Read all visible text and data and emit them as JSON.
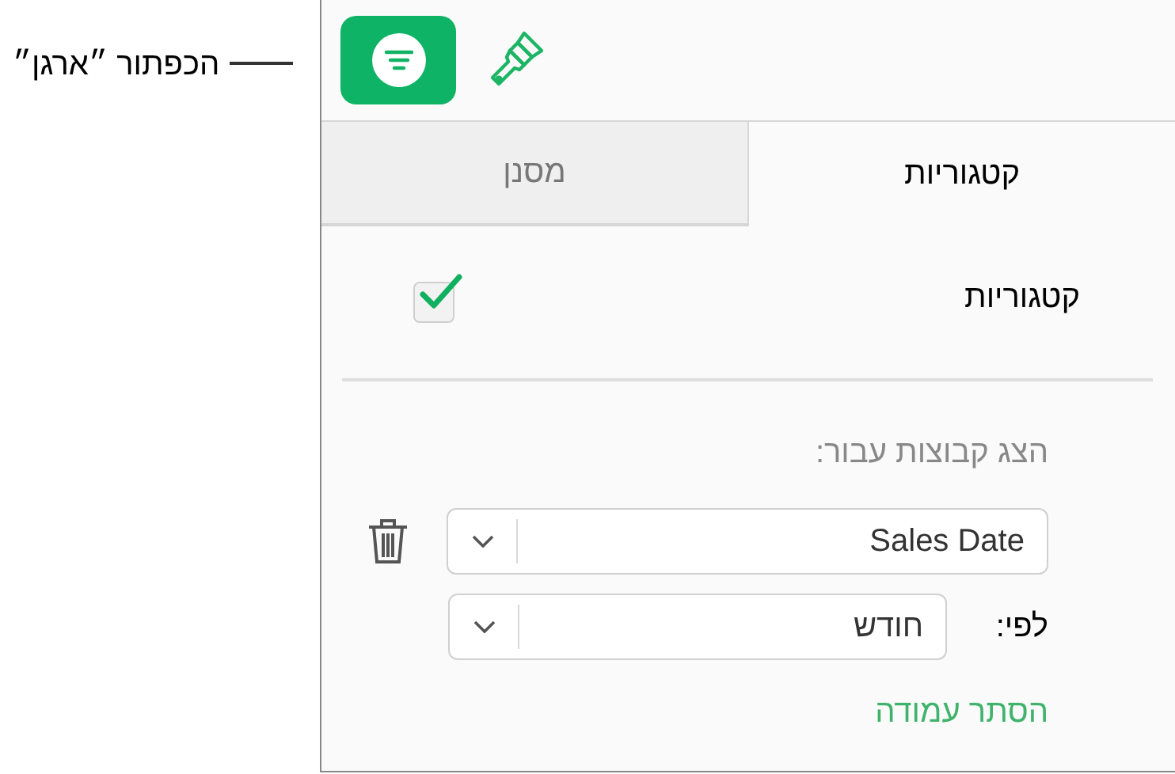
{
  "callout": {
    "label": "הכפתור ״ארגן״"
  },
  "toolbar": [
    {
      "kind": "organize",
      "selected": true
    },
    {
      "kind": "format",
      "selected": false
    }
  ],
  "tabs": [
    {
      "label": "קטגוריות",
      "selected": true
    },
    {
      "label": "מסנן",
      "selected": false
    }
  ],
  "categories_checkbox": {
    "label": "קטגוריות",
    "checked": true
  },
  "group_by": {
    "label": "הצג קבוצות עבור:",
    "column_popup": {
      "value": "Sales Date"
    },
    "by_label": "לפי:",
    "by_popup": {
      "value": "חודש"
    }
  },
  "hide_column_link": "הסתר עמודה"
}
